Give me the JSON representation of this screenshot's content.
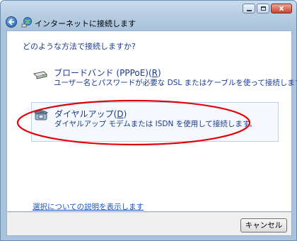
{
  "window": {
    "title": "インターネットに接続します"
  },
  "caption_buttons": {
    "close_label": "x"
  },
  "main": {
    "question": "どのような方法で接続しますか?",
    "options": [
      {
        "title": "ブロードバンド (PPPoE)(",
        "accel": "R",
        "title_end": ")",
        "description": "ユーザー名とパスワードが必要な DSL またはケーブルを使って接続します",
        "icon": "broadband-modem-icon"
      },
      {
        "title": "ダイヤルアップ(",
        "accel": "D",
        "title_end": ")",
        "description": "ダイヤルアップ モデムまたは ISDN を使用して接続します。",
        "icon": "dialup-telephone-icon"
      }
    ],
    "help_link": "選択についての説明を表示します"
  },
  "footer": {
    "cancel_label": "キャンセル"
  },
  "colors": {
    "link": "#1a56c4",
    "heading": "#1a3a8c",
    "highlight_ellipse": "#e0000b"
  }
}
